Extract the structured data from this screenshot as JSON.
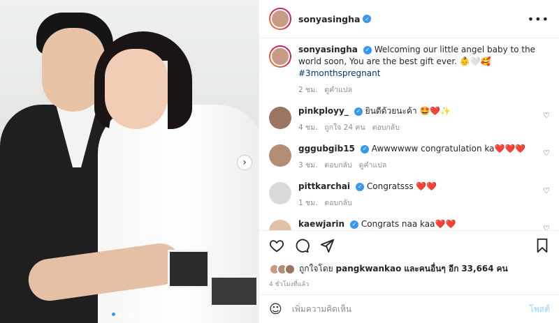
{
  "post": {
    "username": "sonyasingha",
    "caption_text": "Welcoming our little angel baby to the world soon, You are the best gift ever. 👶🤍🥰",
    "hashtag": "#3monthspregnant",
    "caption_time": "2 ชม.",
    "translate": "ดูคำแปล"
  },
  "comments": [
    {
      "user": "pinkployy_",
      "text": "ยินดีด้วยนะค้า 🤩❤️✨",
      "time": "4 ชม.",
      "likes": "ถูกใจ 24 คน",
      "reply": "ตอบกลับ"
    },
    {
      "user": "gggubgib15",
      "text": "Awwwwww congratulation ka❤️❤️❤️",
      "time": "3 ชม.",
      "reply": "ตอบกลับ",
      "translate": "ดูคำแปล"
    },
    {
      "user": "pittkarchai",
      "text": "Congratsss ❤️❤️",
      "time": "1 ชม.",
      "reply": "ตอบกลับ"
    },
    {
      "user": "kaewjarin",
      "text": "Congrats naa kaa❤️❤️"
    }
  ],
  "likes": {
    "prefix": "ถูกใจโดย",
    "user": "pangkwankao",
    "suffix": "และคนอื่นๆ อีก",
    "count": "33,664",
    "unit": "คน"
  },
  "post_time": "4 ชั่วโมงที่แล้ว",
  "add_comment": {
    "placeholder": "เพิ่มความคิดเห็น",
    "post_label": "โพสต์"
  },
  "icons": {
    "like": "heart-icon",
    "comment": "comment-icon",
    "share": "send-icon",
    "save": "bookmark-icon",
    "emoji": "emoji-icon",
    "more": "more-icon",
    "next": "chevron-right-icon"
  },
  "colors": {
    "verified": "#3897f0",
    "link": "#00376b",
    "muted": "#8e8e8e",
    "post_button": "#b2dffc"
  }
}
